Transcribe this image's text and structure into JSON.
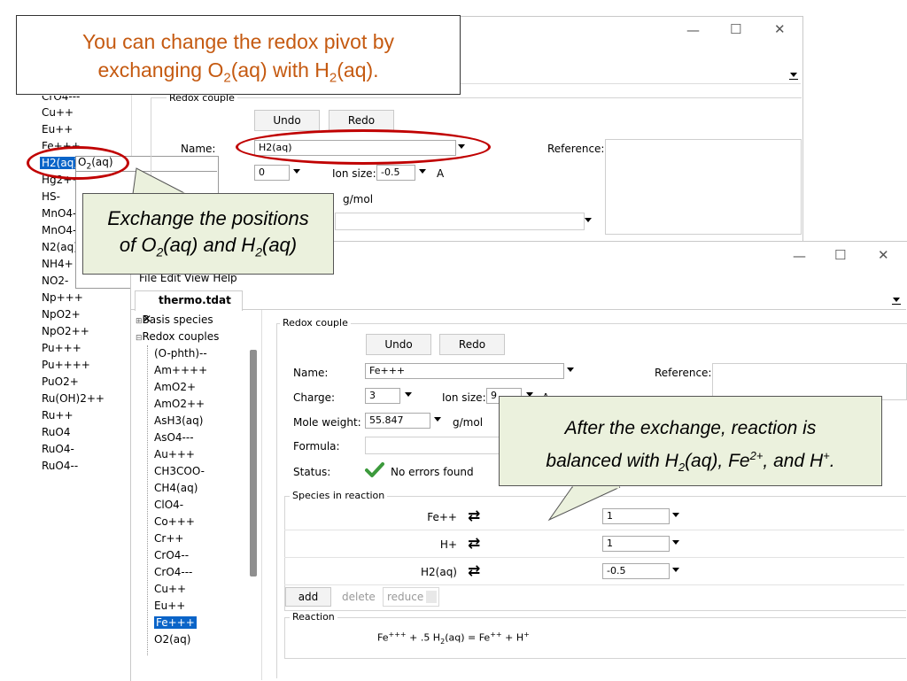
{
  "title_note": {
    "line1": "You can change the redox pivot by",
    "line2_pre": "exchanging O",
    "line2_sub1": "2",
    "line2_mid": "(aq) with H",
    "line2_sub2": "2",
    "line2_post": "(aq).",
    "color": "#c55a11"
  },
  "window_back": {
    "controls": {
      "minimize": "—",
      "maximize": "☐",
      "close": "✕"
    },
    "left_list": [
      "Cu++",
      "Eu++",
      "Fe+++",
      "H2(aq)",
      "Hg2++",
      "HS-",
      "MnO4-",
      "MnO4--",
      "N2(aq)",
      "NH4+",
      "NO2-",
      "Np+++",
      "NpO2+",
      "NpO2++",
      "Pu+++",
      "Pu++++",
      "PuO2+",
      "Ru(OH)2++",
      "Ru++",
      "RuO4",
      "RuO4-",
      "RuO4--"
    ],
    "top_partial_item": "CrO4---",
    "selected_item": "H2(aq)",
    "drag_item_pre": "O",
    "drag_item_sub": "2",
    "drag_item_post": "(aq)",
    "group_label": "Redox couple",
    "undo_label": "Undo",
    "redo_label": "Redo",
    "name_label": "Name:",
    "name_value": "H2(aq)",
    "reference_label": "Reference:",
    "charge_value": "0",
    "ion_size_label": "Ion size:",
    "ion_size_value": "-0.5",
    "ion_size_unit": "A",
    "mole_weight_unit": "g/mol"
  },
  "callout_exchange": {
    "line1": "Exchange the positions",
    "line2_pre": "of O",
    "line2_sub1": "2",
    "line2_mid": "(aq) and H",
    "line2_sub2": "2",
    "line2_post": "(aq)"
  },
  "window_front": {
    "controls": {
      "minimize": "—",
      "maximize": "☐",
      "close": "✕"
    },
    "menu": [
      "File",
      "Edit",
      "View",
      "Help"
    ],
    "tab_label": "thermo.tdat",
    "tab_close": "✕",
    "tree": {
      "basis_species": "Basis species",
      "redox_couples": "Redox couples",
      "items": [
        "(O-phth)--",
        "Am++++",
        "AmO2+",
        "AmO2++",
        "AsH3(aq)",
        "AsO4---",
        "Au+++",
        "CH3COO-",
        "CH4(aq)",
        "ClO4-",
        "Co+++",
        "Cr++",
        "CrO4--",
        "CrO4---",
        "Cu++",
        "Eu++",
        "Fe+++",
        "O2(aq)"
      ],
      "selected": "Fe+++"
    },
    "group_label": "Redox couple",
    "undo_label": "Undo",
    "redo_label": "Redo",
    "name_label": "Name:",
    "name_value": "Fe+++",
    "reference_label": "Reference:",
    "charge_label": "Charge:",
    "charge_value": "3",
    "ion_size_label": "Ion size:",
    "ion_size_value": "9",
    "ion_size_unit": "A",
    "mole_weight_label": "Mole weight:",
    "mole_weight_value": "55.847",
    "mole_weight_unit": "g/mol",
    "formula_label": "Formula:",
    "status_label": "Status:",
    "status_text": "No errors found",
    "species_group_label": "Species in reaction",
    "species": [
      {
        "name": "Fe++",
        "coef": "1"
      },
      {
        "name": "H+",
        "coef": "1"
      },
      {
        "name": "H2(aq)",
        "coef": "-0.5"
      }
    ],
    "add_label": "add",
    "delete_label": "delete",
    "reduce_label": "reduce",
    "reaction_group_label": "Reaction",
    "reaction": {
      "p1": "Fe",
      "s1": "+++",
      "p2": " + .5 H",
      "sb": "2",
      "p3": "(aq) = Fe",
      "s2": "++",
      "p4": " + H",
      "s3": "+"
    },
    "accent": "#0a64c8",
    "ok_color": "#3c9a3c"
  },
  "callout_balanced": {
    "line1": "After the exchange, reaction is",
    "line2_pre": "balanced with H",
    "line2_sub": "2",
    "line2_mid": "(aq), Fe",
    "line2_sup1": "2+",
    "line2_mid2": ", and H",
    "line2_sup2": "+",
    "line2_post": "."
  },
  "highlight_color": "#c00000"
}
